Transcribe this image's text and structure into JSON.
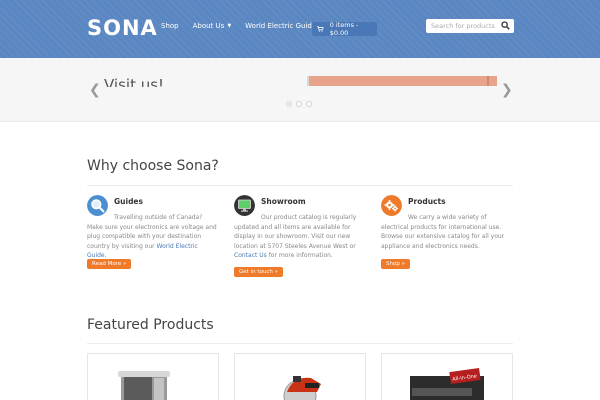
{
  "header": {
    "logo": "SONA",
    "nav": [
      {
        "label": "Shop",
        "has_dropdown": false
      },
      {
        "label": "About Us",
        "has_dropdown": true
      },
      {
        "label": "World Electric Guide",
        "has_dropdown": true
      }
    ],
    "cart_label": "0 items - $0.00",
    "search_placeholder": "Search for products",
    "background_color": "#5a87c2"
  },
  "slider": {
    "title": "Visit us!",
    "prev_icon": "chevron-left-icon",
    "next_icon": "chevron-right-icon",
    "dots": 3,
    "active_dot": 0
  },
  "why": {
    "title": "Why choose Sona?",
    "features": [
      {
        "icon": "search-icon",
        "icon_color": "#4b8fd1",
        "title": "Guides",
        "text_before": "Travelling outside of Canada? Make sure your electronics are voltage and plug compatible with your destination country by visiting our ",
        "link": "World Electric Guide",
        "text_after": ".",
        "button": "Read More »"
      },
      {
        "icon": "monitor-icon",
        "icon_color": "#2a2a2a",
        "title": "Showroom",
        "text_before": "Our product catalog is regularly updated and all items are available for display in our showroom. Visit our new location at 5707 Steeles Avenue West or ",
        "link": "Contact Us",
        "text_after": " for more information.",
        "button": "Get in touch »"
      },
      {
        "icon": "gear-icon",
        "icon_color": "#ee7a2a",
        "title": "Products",
        "text_before": "We carry a wide variety of electrical products for international use. Browse our extensive catalog for all your appliance and electronics needs.",
        "link": "",
        "text_after": "",
        "button": "Shop »"
      }
    ],
    "button_color": "#ee7a2a"
  },
  "featured": {
    "title": "Featured Products",
    "cards": [
      "toaster-oven-image",
      "circular-saw-image",
      "all-in-one-box-image"
    ]
  }
}
